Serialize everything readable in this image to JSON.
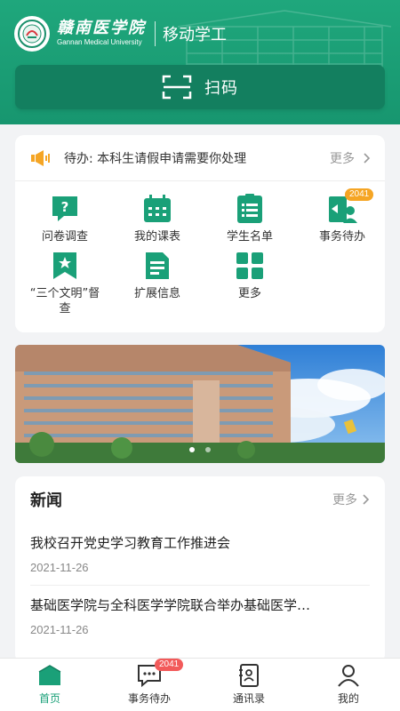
{
  "header": {
    "school_name_cn": "赣南医学院",
    "school_name_en": "Gannan Medical University",
    "app_title": "移动学工",
    "scan_label": "扫码"
  },
  "notice": {
    "icon": "speaker-icon",
    "text": "待办: 本科生请假申请需要你处理",
    "more_label": "更多"
  },
  "grid": [
    {
      "label": "问卷调查",
      "icon": "questionnaire-icon"
    },
    {
      "label": "我的课表",
      "icon": "calendar-icon"
    },
    {
      "label": "学生名单",
      "icon": "list-icon"
    },
    {
      "label": "事务待办",
      "icon": "affairs-icon",
      "badge": "2041"
    },
    {
      "label": "“三个文明”督查",
      "icon": "bookmark-star-icon"
    },
    {
      "label": "扩展信息",
      "icon": "document-icon"
    },
    {
      "label": "更多",
      "icon": "grid-more-icon"
    }
  ],
  "banner": {
    "slides": 2,
    "active_slide": 1
  },
  "news": {
    "title": "新闻",
    "more_label": "更多",
    "items": [
      {
        "headline": "我校召开党史学习教育工作推进会",
        "date": "2021-11-26"
      },
      {
        "headline": "基础医学院与全科医学学院联合举办基础医学…",
        "date": "2021-11-26"
      }
    ]
  },
  "tabbar": {
    "tabs": [
      {
        "label": "首页",
        "icon": "home-icon",
        "active": true
      },
      {
        "label": "事务待办",
        "icon": "chat-icon",
        "badge": "2041"
      },
      {
        "label": "通讯录",
        "icon": "contacts-icon"
      },
      {
        "label": "我的",
        "icon": "user-icon"
      }
    ]
  },
  "colors": {
    "primary": "#1aa078",
    "header_dark": "#137f5f",
    "badge_orange": "#f5a524",
    "badge_red": "#f25a5a"
  }
}
